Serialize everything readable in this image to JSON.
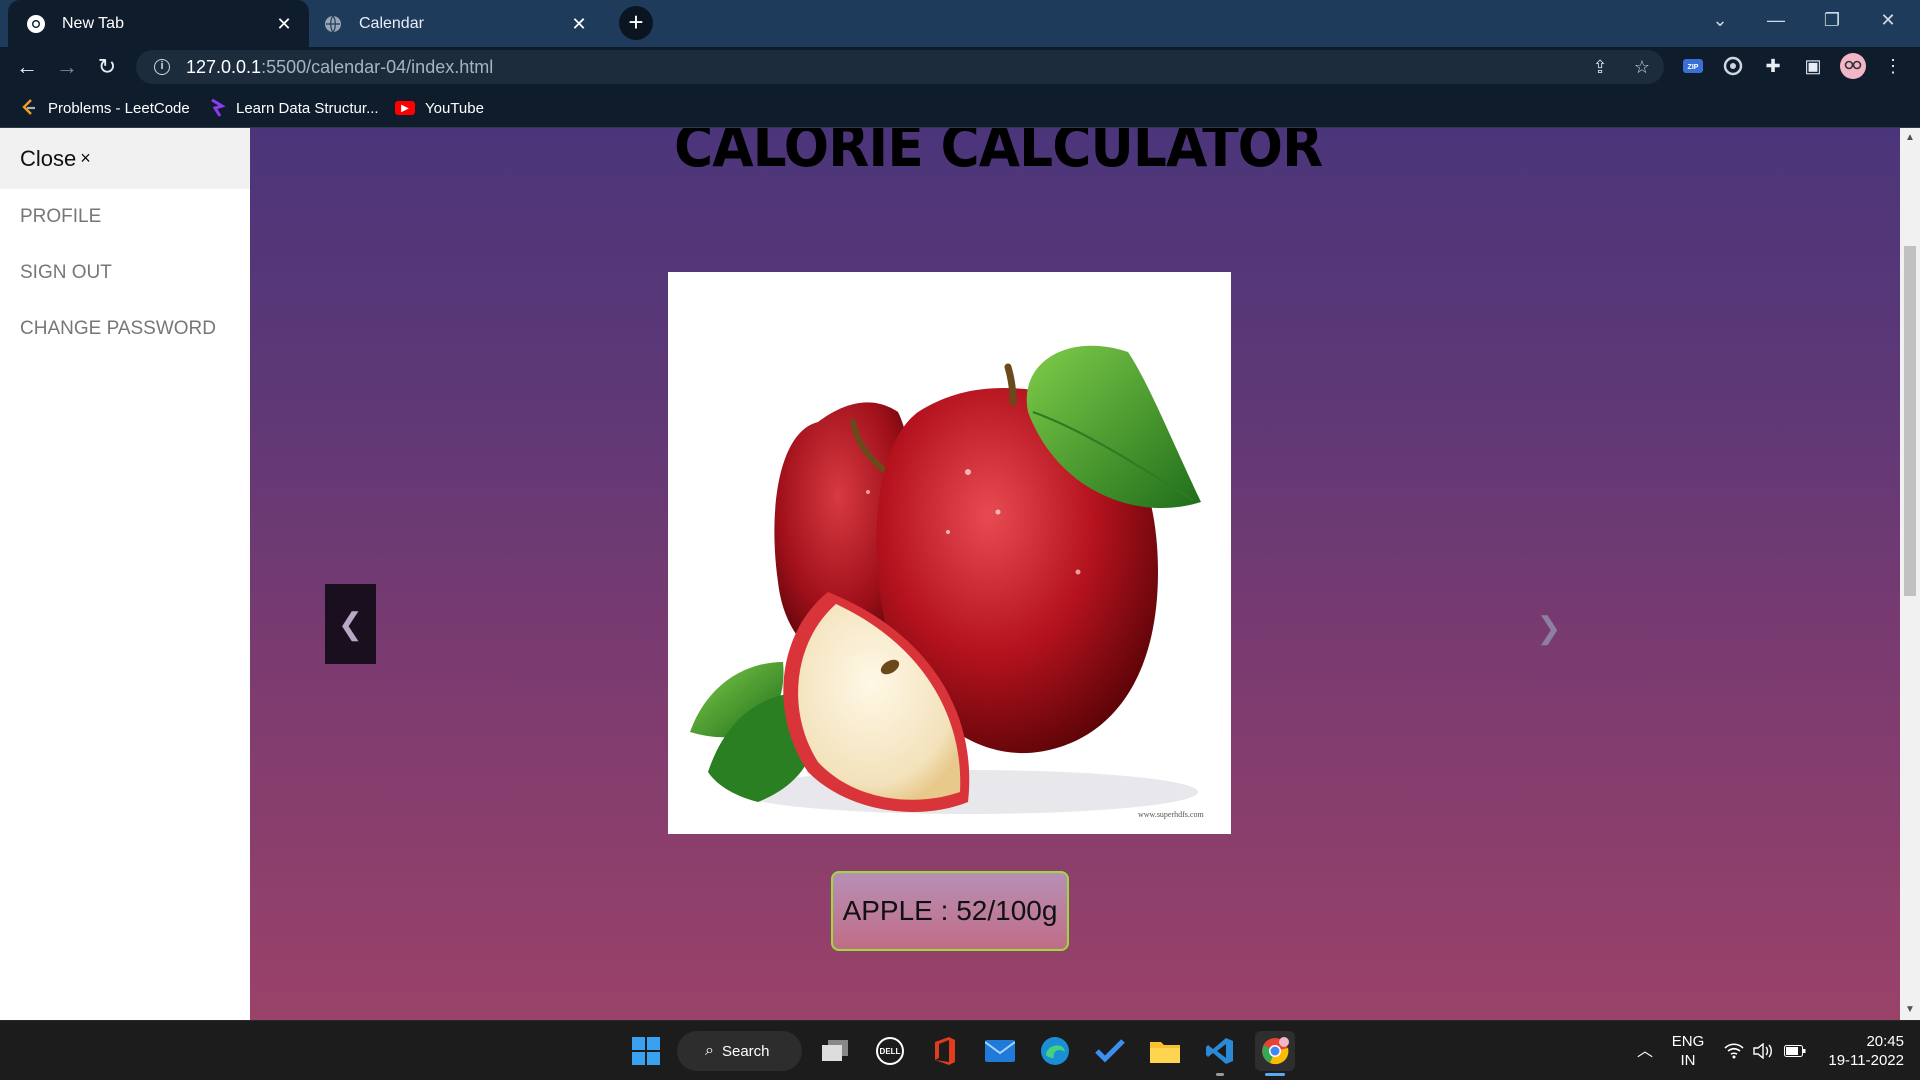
{
  "browser": {
    "tabs": [
      {
        "title": "New Tab",
        "active": true
      },
      {
        "title": "Calendar",
        "active": false
      }
    ],
    "new_tab_symbol": "+",
    "url": {
      "host": "127.0.0.1",
      "rest": ":5500/calendar-04/index.html"
    },
    "bookmarks": [
      {
        "label": "Problems - LeetCode",
        "icon": "leetcode-icon"
      },
      {
        "label": "Learn Data Structur...",
        "icon": "course-icon"
      },
      {
        "label": "YouTube",
        "icon": "youtube-icon"
      }
    ]
  },
  "sidebar": {
    "close_label": "Close",
    "close_symbol": "×",
    "links": [
      {
        "label": "PROFILE"
      },
      {
        "label": "SIGN OUT"
      },
      {
        "label": "CHANGE PASSWORD"
      }
    ]
  },
  "page": {
    "heading": "CALORIE CALCULATOR",
    "slide": {
      "image_watermark": "www.superhdfs.com",
      "prev_symbol": "❮",
      "next_symbol": "❯"
    },
    "calorie_text": "APPLE : 52/100g"
  },
  "taskbar": {
    "search_label": "Search",
    "lang_top": "ENG",
    "lang_bottom": "IN",
    "time": "20:45",
    "date": "19-11-2022"
  },
  "colors": {
    "chrome_frame": "#1f3b5c",
    "chrome_toolbar": "#0e1c2c",
    "gradient_top": "#4b357a",
    "gradient_bottom": "#9a4269",
    "calorie_border": "#9bdc3a"
  }
}
